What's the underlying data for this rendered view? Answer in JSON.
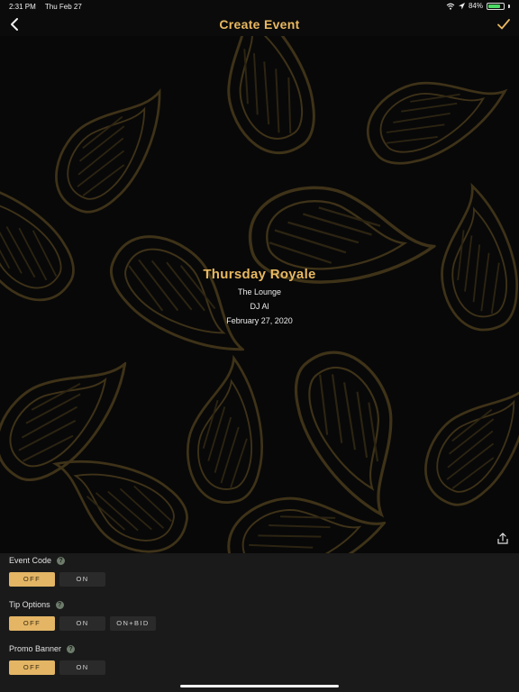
{
  "status": {
    "time": "2:31 PM",
    "date": "Thu Feb 27",
    "battery": "84%",
    "battery_level": 0.84
  },
  "nav": {
    "title": "Create Event"
  },
  "event": {
    "title": "Thursday Royale",
    "venue": "The Lounge",
    "dj": "DJ Al",
    "date": "February 27, 2020"
  },
  "settings": {
    "event_code": {
      "label": "Event Code",
      "options": [
        "OFF",
        "ON"
      ],
      "selected": "OFF"
    },
    "tip_options": {
      "label": "Tip Options",
      "options": [
        "OFF",
        "ON",
        "ON+BID"
      ],
      "selected": "OFF"
    },
    "promo_banner": {
      "label": "Promo Banner",
      "options": [
        "OFF",
        "ON"
      ],
      "selected": "OFF"
    }
  },
  "colors": {
    "accent": "#e8b861",
    "button_active": "#e3b565",
    "pattern": "#3e3218",
    "panel": "#1a1a1a"
  },
  "icons": [
    "chevron-left-icon",
    "checkmark-icon",
    "share-icon",
    "help-icon",
    "wifi-icon",
    "location-icon",
    "battery-icon"
  ]
}
